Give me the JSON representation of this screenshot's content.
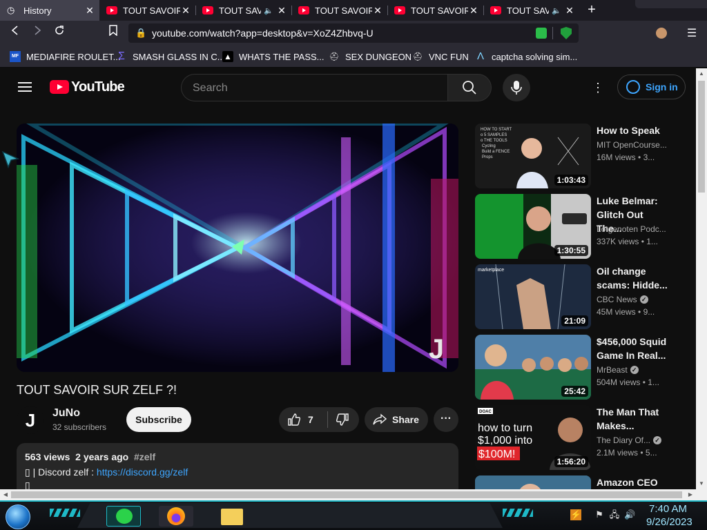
{
  "browser": {
    "tabs": [
      {
        "title": "History",
        "active": true,
        "audio": false
      },
      {
        "title": "TOUT SAVOIR S",
        "active": false,
        "audio": false
      },
      {
        "title": "TOUT SAVO",
        "active": false,
        "audio": true
      },
      {
        "title": "TOUT SAVOIR S",
        "active": false,
        "audio": false
      },
      {
        "title": "TOUT SAVOIR S",
        "active": false,
        "audio": false
      },
      {
        "title": "TOUT SAVO",
        "active": false,
        "audio": true
      }
    ],
    "close_glyph": "✕",
    "new_tab_glyph": "+",
    "speaker_glyph": "🔈",
    "url": "youtube.com/watch?app=desktop&v=XoZ4Zhbvq-U",
    "bookmarks": [
      {
        "label": "MEDIAFIRE ROULET...",
        "icon": "mediafire-icon"
      },
      {
        "label": "SMASH GLASS IN C...",
        "icon": "sigma-icon"
      },
      {
        "label": "WHATS THE PASS...",
        "icon": "ghost-icon"
      },
      {
        "label": "SEX DUNGEON",
        "icon": "helmet-icon"
      },
      {
        "label": "VNC FUN",
        "icon": "helmet-icon"
      },
      {
        "label": "captcha solving sim...",
        "icon": "lambda-icon"
      }
    ]
  },
  "youtube": {
    "logo_text": "YouTube",
    "search_placeholder": "Search",
    "sign_in": "Sign in",
    "video": {
      "title": "TOUT SAVOIR SUR ZELF ?!",
      "channel": "JuNo",
      "channel_initial": "J",
      "subscribers": "32 subscribers",
      "subscribe": "Subscribe",
      "likes": "7",
      "share": "Share",
      "more": "···",
      "views": "563 views",
      "age": "2 years ago",
      "hashtag": "#zelf",
      "desc_prefix": "▯ | Discord zelf : ",
      "desc_link": "https://discord.gg/zelf",
      "desc_line2": "▯"
    },
    "recommendations": [
      {
        "title_1": "How to Speak",
        "title_2": "",
        "channel": "MIT OpenCourse...",
        "verified": false,
        "views": "16M views",
        "age": "• 3...",
        "duration": "1:03:43"
      },
      {
        "title_1": "Luke Belmar:",
        "title_2": "Glitch Out The...",
        "channel": "Lotgenoten Podc...",
        "verified": false,
        "views": "337K views",
        "age": "• 1...",
        "duration": "1:30:55"
      },
      {
        "title_1": "Oil change",
        "title_2": "scams: Hidde...",
        "channel": "CBC News",
        "verified": true,
        "views": "45M views",
        "age": "• 9...",
        "duration": "21:09"
      },
      {
        "title_1": "$456,000 Squid",
        "title_2": "Game In Real...",
        "channel": "MrBeast",
        "verified": true,
        "views": "504M views",
        "age": "• 1...",
        "duration": "25:42"
      },
      {
        "title_1": "The Man That",
        "title_2": "Makes...",
        "channel": "The Diary Of...",
        "verified": true,
        "views": "2.1M views",
        "age": "• 5...",
        "duration": "1:56:20"
      },
      {
        "title_1": "Amazon CEO",
        "title_2": "",
        "channel": "",
        "verified": false,
        "views": "",
        "age": "",
        "duration": ""
      }
    ],
    "thumb_text": {
      "t1_board": "HOW TO START\no 5 SAMPLES\no THE TOOLS\n  Cycling\n  Build a FENCE\n  Props",
      "t3_brand": "marketplace",
      "t5_badge": "DOAC",
      "t5_line1": "how to turn",
      "t5_line2": "$1,000 into",
      "t5_line3": "$100M!"
    }
  },
  "taskbar": {
    "time": "7:40 AM",
    "date": "9/26/2023"
  }
}
